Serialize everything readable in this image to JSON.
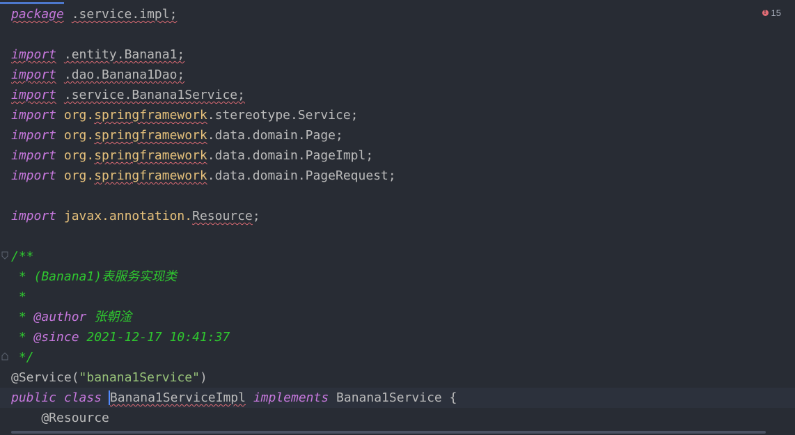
{
  "editor": {
    "error_count": "15",
    "lines": [
      {
        "segments": [
          {
            "t": "package",
            "c": "kw sq"
          },
          {
            "t": " ",
            "c": "plain"
          },
          {
            "t": ".service.impl;",
            "c": "plain sq"
          }
        ]
      },
      {
        "segments": []
      },
      {
        "segments": [
          {
            "t": "import",
            "c": "kw sq"
          },
          {
            "t": " ",
            "c": "plain"
          },
          {
            "t": ".entity.Banana1;",
            "c": "plain sq"
          }
        ]
      },
      {
        "segments": [
          {
            "t": "import",
            "c": "kw sq"
          },
          {
            "t": " ",
            "c": "plain"
          },
          {
            "t": ".dao.Banana1Dao;",
            "c": "plain sq"
          }
        ]
      },
      {
        "segments": [
          {
            "t": "import",
            "c": "kw sq"
          },
          {
            "t": " ",
            "c": "plain"
          },
          {
            "t": ".service.Banana1Service;",
            "c": "plain sq"
          }
        ]
      },
      {
        "segments": [
          {
            "t": "import",
            "c": "kw"
          },
          {
            "t": " org.",
            "c": "pkg"
          },
          {
            "t": "springframework",
            "c": "pkg sq"
          },
          {
            "t": ".stereotype.Service;",
            "c": "plain"
          }
        ]
      },
      {
        "segments": [
          {
            "t": "import",
            "c": "kw"
          },
          {
            "t": " org.",
            "c": "pkg"
          },
          {
            "t": "springframework",
            "c": "pkg sq"
          },
          {
            "t": ".data.domain.Page;",
            "c": "plain"
          }
        ]
      },
      {
        "segments": [
          {
            "t": "import",
            "c": "kw"
          },
          {
            "t": " org.",
            "c": "pkg"
          },
          {
            "t": "springframework",
            "c": "pkg sq"
          },
          {
            "t": ".data.domain.PageImpl;",
            "c": "plain"
          }
        ]
      },
      {
        "segments": [
          {
            "t": "import",
            "c": "kw"
          },
          {
            "t": " org.",
            "c": "pkg"
          },
          {
            "t": "springframework",
            "c": "pkg sq"
          },
          {
            "t": ".data.domain.PageRequest;",
            "c": "plain"
          }
        ]
      },
      {
        "segments": []
      },
      {
        "segments": [
          {
            "t": "import",
            "c": "kw"
          },
          {
            "t": " javax.annotation.",
            "c": "pkg"
          },
          {
            "t": "Resource",
            "c": "plain sq"
          },
          {
            "t": ";",
            "c": "plain"
          }
        ]
      },
      {
        "segments": []
      },
      {
        "segments": [
          {
            "t": "/**",
            "c": "cm"
          }
        ]
      },
      {
        "segments": [
          {
            "t": " * (Banana1)表服务实现类",
            "c": "cm"
          }
        ]
      },
      {
        "segments": [
          {
            "t": " *",
            "c": "cm"
          }
        ]
      },
      {
        "segments": [
          {
            "t": " * ",
            "c": "cm"
          },
          {
            "t": "@author",
            "c": "cm-tag"
          },
          {
            "t": " 张朝淦",
            "c": "cm"
          }
        ]
      },
      {
        "segments": [
          {
            "t": " * ",
            "c": "cm"
          },
          {
            "t": "@since",
            "c": "cm-tag"
          },
          {
            "t": " 2021-12-17 10:41:37",
            "c": "cm"
          }
        ]
      },
      {
        "segments": [
          {
            "t": " */",
            "c": "cm"
          }
        ]
      },
      {
        "segments": [
          {
            "t": "@Service(",
            "c": "plain"
          },
          {
            "t": "\"banana1Service\"",
            "c": "str"
          },
          {
            "t": ")",
            "c": "plain"
          }
        ]
      },
      {
        "segments": [
          {
            "t": "public",
            "c": "kw"
          },
          {
            "t": " ",
            "c": "plain"
          },
          {
            "t": "class",
            "c": "kw"
          },
          {
            "t": " ",
            "c": "plain"
          },
          {
            "t": "Banana1ServiceImpl",
            "c": "plain sq caret"
          },
          {
            "t": " ",
            "c": "plain"
          },
          {
            "t": "implements",
            "c": "kw"
          },
          {
            "t": " Banana1Service {",
            "c": "plain"
          }
        ]
      },
      {
        "segments": [
          {
            "t": "    @Resource",
            "c": "plain"
          }
        ]
      }
    ]
  }
}
